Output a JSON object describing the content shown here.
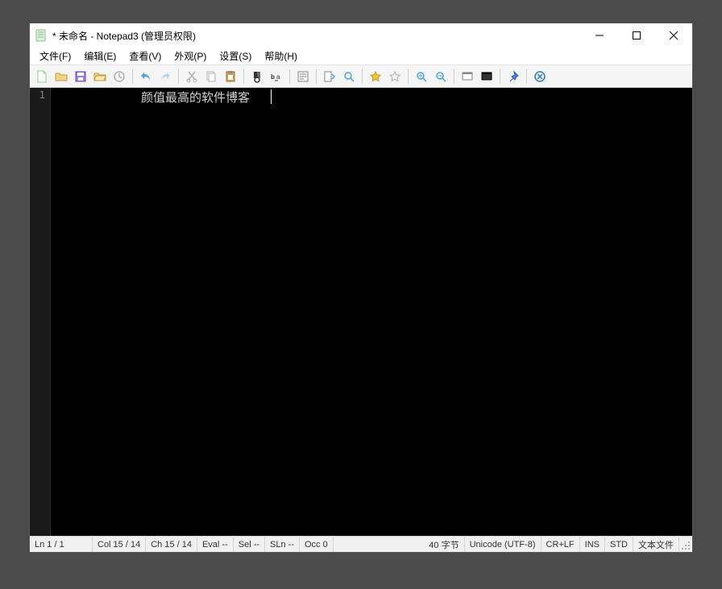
{
  "window": {
    "title": "* 未命名 - Notepad3  (管理员权限)"
  },
  "menus": {
    "file": "文件(F)",
    "edit": "编辑(E)",
    "view": "查看(V)",
    "appearance": "外观(P)",
    "settings": "设置(S)",
    "help": "帮助(H)"
  },
  "editor": {
    "line_number": "1",
    "content": "颜值最高的软件博客"
  },
  "statusbar": {
    "ln": "Ln  1 / 1",
    "col": "Col  15 / 14",
    "ch": "Ch  15 / 14",
    "eval": "Eval  --",
    "sel": "Sel  --",
    "sln": "SLn  --",
    "occ": "Occ  0",
    "bytes": "40 字节",
    "encoding": "Unicode (UTF-8)",
    "eol": "CR+LF",
    "ovr": "INS",
    "mode": "STD",
    "filetype": "文本文件"
  },
  "colors": {
    "new_file": "#8fd18f",
    "open_folder": "#e2b24a",
    "save": "#7a5ed0",
    "undo": "#3a8fe0",
    "redo": "#3a8fe0",
    "star": "#f0c23a",
    "pin": "#3a73d8",
    "close_circle": "#2a7ec8"
  }
}
